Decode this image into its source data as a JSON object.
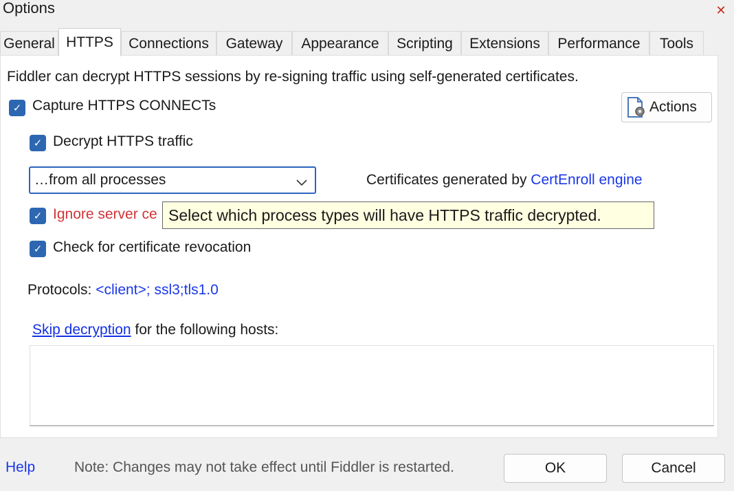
{
  "window": {
    "title": "Options",
    "close_glyph": "✕"
  },
  "tabs": [
    {
      "label": "General"
    },
    {
      "label": "HTTPS"
    },
    {
      "label": "Connections"
    },
    {
      "label": "Gateway"
    },
    {
      "label": "Appearance"
    },
    {
      "label": "Scripting"
    },
    {
      "label": "Extensions"
    },
    {
      "label": "Performance"
    },
    {
      "label": "Tools"
    }
  ],
  "active_tab": "HTTPS",
  "https": {
    "intro": "Fiddler can decrypt HTTPS sessions by re-signing traffic using self-generated certificates.",
    "capture_label": "Capture HTTPS CONNECTs",
    "capture_checked": true,
    "actions_label": "Actions",
    "decrypt_label": "Decrypt HTTPS traffic",
    "decrypt_checked": true,
    "process_select_value": "…from all processes",
    "certs_prefix": "Certificates generated by ",
    "certs_engine": "CertEnroll engine",
    "ignore_label_visible": "Ignore server ce",
    "ignore_checked": true,
    "tooltip": "Select which process types will have HTTPS traffic decrypted.",
    "revocation_label": "Check for certificate revocation",
    "revocation_checked": true,
    "protocols_prefix": "Protocols: ",
    "protocols_value": "<client>; ssl3;tls1.0",
    "skip_link": "Skip decryption",
    "skip_suffix": " for the following hosts:",
    "skip_hosts_value": ""
  },
  "footer": {
    "help": "Help",
    "note": "Note: Changes may not take effect until Fiddler is restarted.",
    "ok": "OK",
    "cancel": "Cancel"
  },
  "colors": {
    "accent": "#2e67b1",
    "link": "#1a37e8",
    "warning_text": "#d13438",
    "tooltip_bg": "#ffffe1"
  },
  "icons": {
    "close": "close-icon",
    "actions": "certificate-gear-icon",
    "dropdown": "chevron-down-icon",
    "checkbox": "checkmark-icon"
  }
}
